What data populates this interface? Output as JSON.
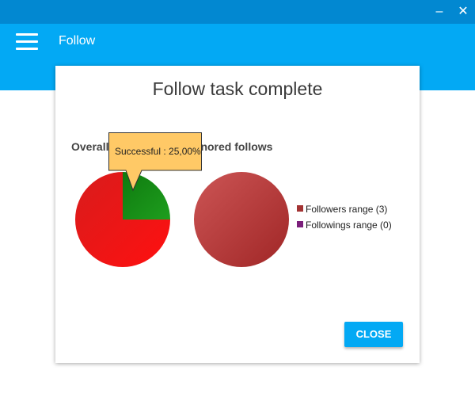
{
  "window": {
    "minimize_glyph": "–",
    "close_glyph": "✕"
  },
  "appbar": {
    "title": "Follow",
    "menu_icon": "hamburger-menu-icon"
  },
  "dialog": {
    "title": "Follow task complete",
    "close_label": "CLOSE"
  },
  "colors": {
    "accent": "#03a9f4",
    "titlebar": "#0288d1",
    "success": "#1a8a1a",
    "fail": "#ff0000",
    "followers": "#a33333",
    "followings": "#7b1f7b",
    "tooltip": "#ffc966"
  },
  "chart_data": [
    {
      "type": "pie",
      "title": "Overall",
      "slices": [
        {
          "label": "Successful",
          "value": 25.0,
          "color": "#1a8a1a"
        },
        {
          "label": "",
          "value": 75.0,
          "color": "#ff0000"
        }
      ],
      "tooltip": "Successful : 25,00%"
    },
    {
      "type": "pie",
      "title": "Ignored follows",
      "slices": [
        {
          "label": "Followers range",
          "value": 3,
          "color": "#a33333"
        },
        {
          "label": "Followings range",
          "value": 0,
          "color": "#7b1f7b"
        }
      ],
      "legend": [
        "Followers range (3)",
        "Followings range (0)"
      ]
    }
  ]
}
